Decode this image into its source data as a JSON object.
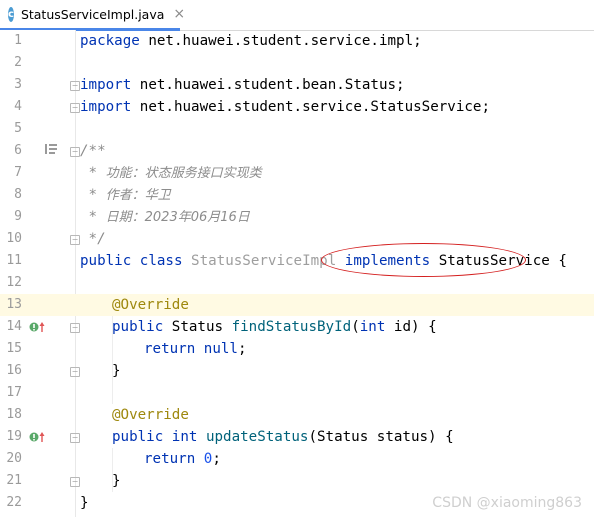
{
  "tab": {
    "label": "StatusServiceImpl.java",
    "icon": "java-class-icon",
    "close": "×"
  },
  "lines": [
    {
      "n": "1"
    },
    {
      "n": "2"
    },
    {
      "n": "3"
    },
    {
      "n": "4"
    },
    {
      "n": "5"
    },
    {
      "n": "6"
    },
    {
      "n": "7"
    },
    {
      "n": "8"
    },
    {
      "n": "9"
    },
    {
      "n": "10"
    },
    {
      "n": "11"
    },
    {
      "n": "12"
    },
    {
      "n": "13"
    },
    {
      "n": "14"
    },
    {
      "n": "15"
    },
    {
      "n": "16"
    },
    {
      "n": "17"
    },
    {
      "n": "18"
    },
    {
      "n": "19"
    },
    {
      "n": "20"
    },
    {
      "n": "21"
    },
    {
      "n": "22"
    }
  ],
  "code": {
    "l1_kw": "package",
    "l1_rest": " net.huawei.student.service.impl;",
    "l3_kw": "import",
    "l3_rest": " net.huawei.student.bean.Status;",
    "l4_kw": "import",
    "l4_rest": " net.huawei.student.service.StatusService;",
    "l6": "/**",
    "l7_star": " * ",
    "l7_text": "功能：状态服务接口实现类",
    "l8_star": " * ",
    "l8_text": "作者：华卫",
    "l9_star": " * ",
    "l9_text": "日期：2023年06月16日",
    "l10": " */",
    "l11_kw": "public class",
    "l11_name": " StatusServiceImpl ",
    "l11_impl": "implements",
    "l11_rest": " StatusService {",
    "l13": "@Override",
    "l14_kw": "public",
    "l14_type": " Status ",
    "l14_method": "findStatusById",
    "l14_p1": "(",
    "l14_int": "int",
    "l14_rest": " id) {",
    "l15_kw": "return null",
    "l15_rest": ";",
    "l16": "}",
    "l18": "@Override",
    "l19_kw": "public int",
    "l19_sp": " ",
    "l19_method": "updateStatus",
    "l19_rest": "(Status status) {",
    "l20_kw": "return",
    "l20_sp": " ",
    "l20_num": "0",
    "l20_rest": ";",
    "l21": "}",
    "l22": "}"
  },
  "watermark": "CSDN @xiaoming863",
  "colors": {
    "keyword": "#0033b3",
    "annotation": "#9e880d",
    "number": "#1750eb",
    "comment": "#8c8c8c",
    "highlight_oval": "#d41f1f"
  }
}
